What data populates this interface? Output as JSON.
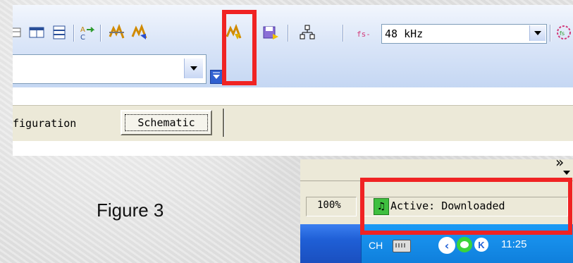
{
  "toolbar": {
    "fs_label": "fs-",
    "sample_rate": "48 kHz",
    "icons": [
      "table-icon",
      "columns-icon",
      "rows-icon",
      "spell-check-icon",
      "build-icon",
      "build-blue-icon",
      "download-icon",
      "save-download-icon",
      "hierarchy-icon",
      "fs-settings-icon"
    ]
  },
  "tabs": {
    "configuration_partial": "figuration",
    "schematic": "Schematic"
  },
  "status": {
    "zoom": "100%",
    "active_status": "Active: Downloaded"
  },
  "taskbar": {
    "language": "CH",
    "clock": "11:25"
  },
  "figure": {
    "label": "Figure 3"
  },
  "colors": {
    "highlight": "#f02323",
    "toolbar_blue": "#c5d7f3",
    "taskbar_blue": "#1f5fd6"
  }
}
